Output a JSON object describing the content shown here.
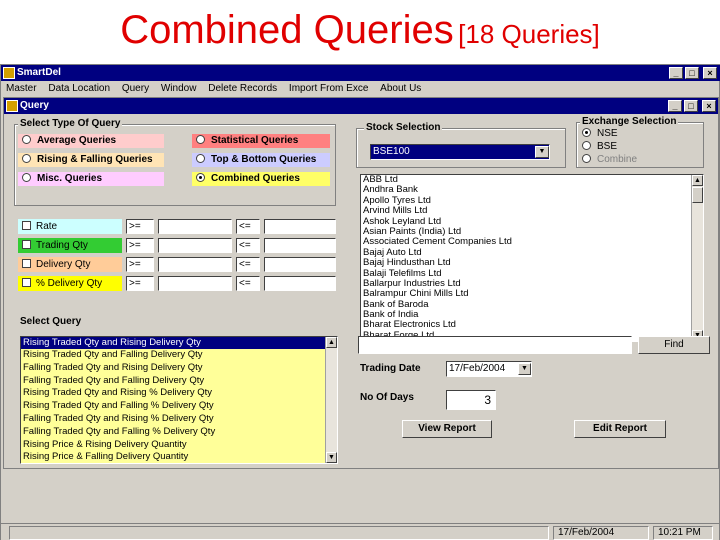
{
  "slide": {
    "title_main": "Combined Queries",
    "title_sub": "[18 Queries]"
  },
  "app": {
    "title": "SmartDel",
    "menu": [
      "Master",
      "Data Location",
      "Query",
      "Window",
      "Delete Records",
      "Import From Exce",
      "About Us"
    ]
  },
  "query_window": {
    "title": "Query",
    "type_group": {
      "label": "Select Type Of Query",
      "options": [
        {
          "label": "Average Queries",
          "color": "#ffcccc"
        },
        {
          "label": "Rising & Falling Queries",
          "color": "#ffe4b5"
        },
        {
          "label": "Misc. Queries",
          "color": "#ffccff"
        },
        {
          "label": "Statistical Queries",
          "color": "#ff8080"
        },
        {
          "label": "Top & Bottom Queries",
          "color": "#ccccff"
        },
        {
          "label": "Combined Queries",
          "color": "#ffff66"
        }
      ],
      "selected": "Combined Queries"
    },
    "criteria": [
      {
        "label": "Rate",
        "color": "#ccffff",
        "gte": ">=",
        "lte": "<="
      },
      {
        "label": "Trading Qty",
        "color": "#33cc33",
        "gte": ">=",
        "lte": "<="
      },
      {
        "label": "Delivery Qty",
        "color": "#ffcc99",
        "gte": ">=",
        "lte": "<="
      },
      {
        "label": "% Delivery Qty",
        "color": "#ffff00",
        "gte": ">=",
        "lte": "<="
      }
    ],
    "select_query": {
      "label": "Select Query",
      "items": [
        "Rising Traded Qty and Rising Delivery Qty",
        "Rising Traded Qty and Falling Delivery Qty",
        "Falling Traded Qty and Rising Delivery Qty",
        "Falling Traded Qty and Falling Delivery Qty",
        "Rising Traded Qty and Rising % Delivery Qty",
        "Rising Traded Qty and Falling % Delivery Qty",
        "Falling Traded Qty and Rising % Delivery Qty",
        "Falling Traded Qty and Falling % Delivery Qty",
        "Rising Price & Rising Delivery Quantity",
        "Rising Price & Falling Delivery Quantity"
      ]
    },
    "stock_selection": {
      "label": "Stock Selection",
      "selected_index": "BSE100",
      "stocks": [
        "ABB Ltd",
        "Andhra Bank",
        "Apollo Tyres Ltd",
        "Arvind Mills Ltd",
        "Ashok Leyland Ltd",
        "Asian Paints (India) Ltd",
        "Associated Cement Companies Ltd",
        "Bajaj Auto Ltd",
        "Bajaj Hindusthan Ltd",
        "Balaji Telefilms Ltd",
        "Ballarpur Industries Ltd",
        "Balrampur Chini Mills Ltd",
        "Bank of Baroda",
        "Bank of India",
        "Bharat Electronics Ltd",
        "Bharat Forge Ltd"
      ]
    },
    "exchange": {
      "label": "Exchange Selection",
      "options": [
        "NSE",
        "BSE",
        "Combine"
      ],
      "selected": "NSE"
    },
    "find": {
      "value": "",
      "button": "Find"
    },
    "trading_date": {
      "label": "Trading Date",
      "value": "17/Feb/2004"
    },
    "no_of_days": {
      "label": "No Of Days",
      "value": "3"
    },
    "buttons": {
      "view_report": "View Report",
      "edit_report": "Edit Report"
    }
  },
  "status_bar": {
    "date": "17/Feb/2004",
    "time": "10:21 PM"
  }
}
